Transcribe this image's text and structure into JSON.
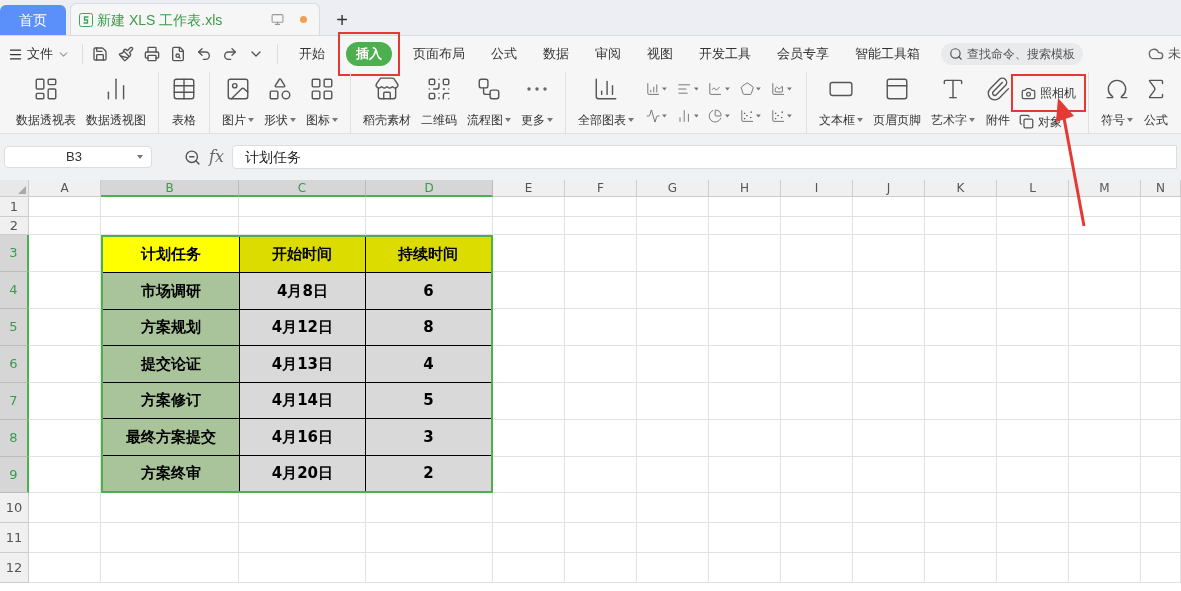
{
  "tabs": [
    {
      "label": "首页",
      "kind": "home",
      "selected": false
    },
    {
      "label": "新建 XLS 工作表.xls",
      "kind": "document",
      "selected": true,
      "unsaved": true
    }
  ],
  "new_tab": "+",
  "menu": {
    "file": "文件",
    "tabs": [
      {
        "label": "开始",
        "selected": false,
        "highlighted": false
      },
      {
        "label": "插入",
        "selected": true,
        "highlighted": true
      },
      {
        "label": "页面布局",
        "selected": false,
        "highlighted": false
      },
      {
        "label": "公式",
        "selected": false,
        "highlighted": false
      },
      {
        "label": "数据",
        "selected": false,
        "highlighted": false
      },
      {
        "label": "审阅",
        "selected": false,
        "highlighted": false
      },
      {
        "label": "视图",
        "selected": false,
        "highlighted": false
      },
      {
        "label": "开发工具",
        "selected": false,
        "highlighted": false
      },
      {
        "label": "会员专享",
        "selected": false,
        "highlighted": false
      },
      {
        "label": "智能工具箱",
        "selected": false,
        "highlighted": false
      }
    ],
    "search": {
      "placeholder": "查找命令、搜索模板"
    },
    "cloud": "未"
  },
  "ribbon": [
    {
      "items": [
        {
          "kind": "large",
          "label": "数据透视表",
          "dropdown": false
        },
        {
          "kind": "large",
          "label": "数据透视图",
          "dropdown": false
        }
      ]
    },
    {
      "items": [
        {
          "kind": "large",
          "label": "表格",
          "dropdown": false
        }
      ]
    },
    {
      "items": [
        {
          "kind": "large",
          "label": "图片",
          "dropdown": true
        },
        {
          "kind": "large",
          "label": "形状",
          "dropdown": true
        },
        {
          "kind": "large",
          "label": "图标",
          "dropdown": true
        }
      ]
    },
    {
      "items": [
        {
          "kind": "large",
          "label": "稻壳素材",
          "dropdown": false
        },
        {
          "kind": "large",
          "label": "二维码",
          "dropdown": false
        },
        {
          "kind": "large",
          "label": "流程图",
          "dropdown": true
        },
        {
          "kind": "large",
          "label": "更多",
          "dropdown": true
        }
      ]
    },
    {
      "items": [
        {
          "kind": "large",
          "label": "全部图表",
          "dropdown": true
        },
        {
          "kind": "chart_grid"
        }
      ]
    },
    {
      "items": [
        {
          "kind": "large",
          "label": "文本框",
          "dropdown": true
        },
        {
          "kind": "large",
          "label": "页眉页脚",
          "dropdown": false
        },
        {
          "kind": "large",
          "label": "艺术字",
          "dropdown": true
        },
        {
          "kind": "large",
          "label": "附件",
          "dropdown": false
        },
        {
          "kind": "stack",
          "items": [
            {
              "label": "照相机",
              "highlighted": true
            },
            {
              "label": "对象",
              "highlighted": false
            }
          ]
        }
      ]
    },
    {
      "items": [
        {
          "kind": "large",
          "label": "符号",
          "dropdown": true
        },
        {
          "kind": "large",
          "label": "公式",
          "dropdown": false
        }
      ]
    }
  ],
  "formula_bar": {
    "name_box": "B3",
    "fx": "fx",
    "value": "计划任务"
  },
  "sheet": {
    "columns": [
      {
        "label": "A",
        "selected": false
      },
      {
        "label": "B",
        "selected": true
      },
      {
        "label": "C",
        "selected": true
      },
      {
        "label": "D",
        "selected": true
      },
      {
        "label": "E",
        "selected": false
      },
      {
        "label": "F",
        "selected": false
      },
      {
        "label": "G",
        "selected": false
      },
      {
        "label": "H",
        "selected": false
      },
      {
        "label": "I",
        "selected": false
      },
      {
        "label": "J",
        "selected": false
      },
      {
        "label": "K",
        "selected": false
      },
      {
        "label": "L",
        "selected": false
      },
      {
        "label": "M",
        "selected": false
      },
      {
        "label": "N",
        "selected": false
      }
    ],
    "rows": [
      {
        "label": "1",
        "selected": false
      },
      {
        "label": "2",
        "selected": false
      },
      {
        "label": "3",
        "selected": true
      },
      {
        "label": "4",
        "selected": true
      },
      {
        "label": "5",
        "selected": true
      },
      {
        "label": "6",
        "selected": true
      },
      {
        "label": "7",
        "selected": true
      },
      {
        "label": "8",
        "selected": true
      },
      {
        "label": "9",
        "selected": true
      },
      {
        "label": "10",
        "selected": false
      },
      {
        "label": "11",
        "selected": false
      },
      {
        "label": "12",
        "selected": false
      }
    ],
    "table": {
      "header": [
        "计划任务",
        "开始时间",
        "持续时间"
      ],
      "rows": [
        [
          "市场调研",
          "4月8日",
          "6"
        ],
        [
          "方案规划",
          "4月12日",
          "8"
        ],
        [
          "提交论证",
          "4月13日",
          "4"
        ],
        [
          "方案修订",
          "4月14日",
          "5"
        ],
        [
          "最终方案提交",
          "4月16日",
          "3"
        ],
        [
          "方案终审",
          "4月20日",
          "2"
        ]
      ]
    }
  },
  "annotation": {
    "kind": "arrow"
  }
}
